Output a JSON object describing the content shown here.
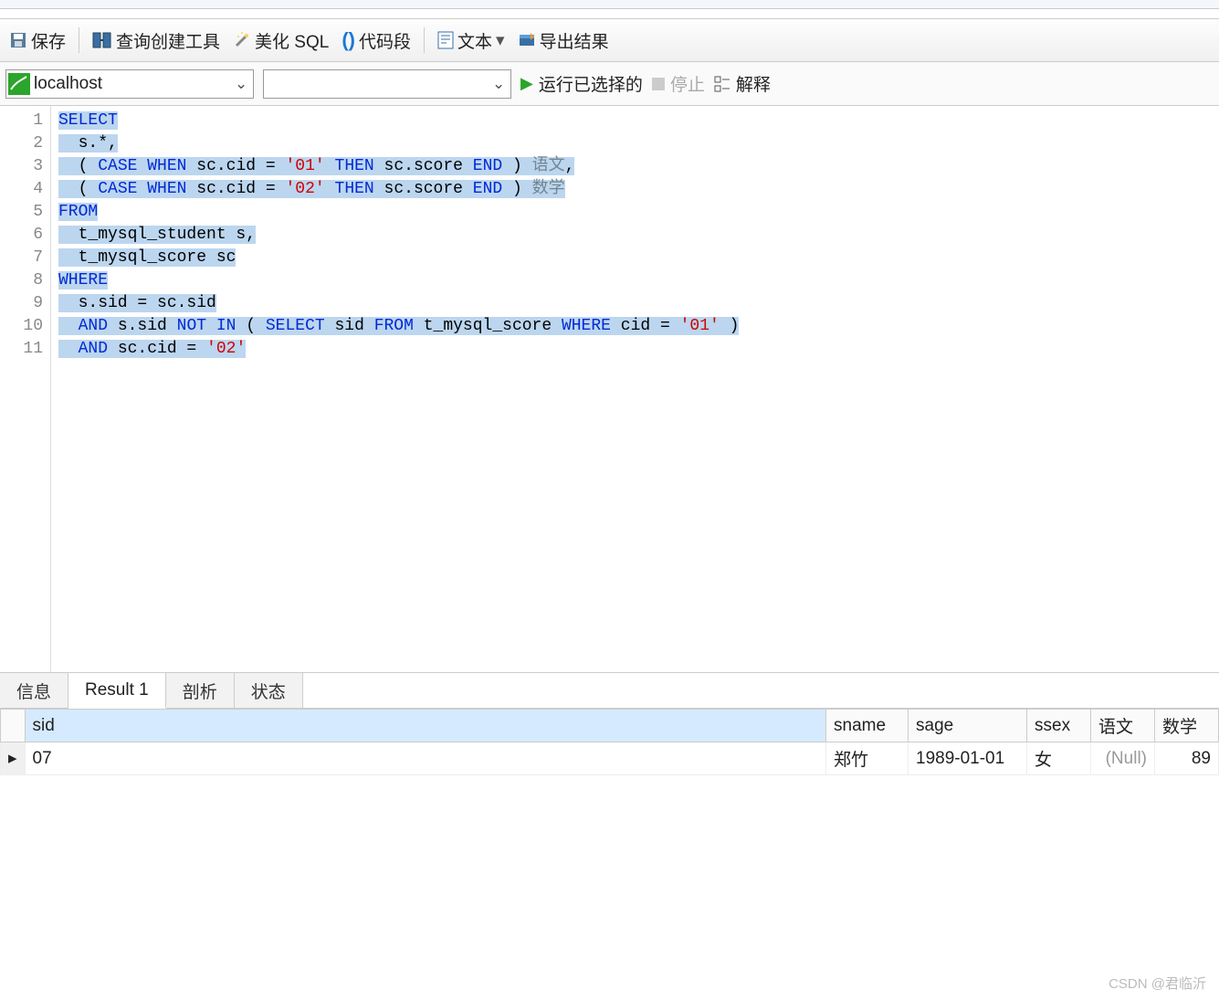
{
  "toolbar": {
    "save": "保存",
    "query_builder": "查询创建工具",
    "beautify": "美化 SQL",
    "snippet": "代码段",
    "text": "文本",
    "export": "导出结果"
  },
  "toolbar2": {
    "connection": "localhost",
    "run_selected": "运行已选择的",
    "stop": "停止",
    "explain": "解释"
  },
  "code": {
    "lines": [
      {
        "n": "1",
        "tokens": [
          {
            "c": "kw",
            "t": "SELECT"
          }
        ],
        "sel": true
      },
      {
        "n": "2",
        "tokens": [
          {
            "c": "txt",
            "t": "  s.*,"
          }
        ],
        "sel": true
      },
      {
        "n": "3",
        "tokens": [
          {
            "c": "txt",
            "t": "  ( "
          },
          {
            "c": "kw",
            "t": "CASE"
          },
          {
            "c": "txt",
            "t": " "
          },
          {
            "c": "kw",
            "t": "WHEN"
          },
          {
            "c": "txt",
            "t": " sc.cid = "
          },
          {
            "c": "str",
            "t": "'01'"
          },
          {
            "c": "txt",
            "t": " "
          },
          {
            "c": "kw",
            "t": "THEN"
          },
          {
            "c": "txt",
            "t": " sc.score "
          },
          {
            "c": "kw",
            "t": "END"
          },
          {
            "c": "txt",
            "t": " ) "
          },
          {
            "c": "fn",
            "t": "语文"
          },
          {
            "c": "txt",
            "t": ","
          }
        ],
        "sel": true
      },
      {
        "n": "4",
        "tokens": [
          {
            "c": "txt",
            "t": "  ( "
          },
          {
            "c": "kw",
            "t": "CASE"
          },
          {
            "c": "txt",
            "t": " "
          },
          {
            "c": "kw",
            "t": "WHEN"
          },
          {
            "c": "txt",
            "t": " sc.cid = "
          },
          {
            "c": "str",
            "t": "'02'"
          },
          {
            "c": "txt",
            "t": " "
          },
          {
            "c": "kw",
            "t": "THEN"
          },
          {
            "c": "txt",
            "t": " sc.score "
          },
          {
            "c": "kw",
            "t": "END"
          },
          {
            "c": "txt",
            "t": " ) "
          },
          {
            "c": "fn",
            "t": "数学"
          }
        ],
        "sel": true
      },
      {
        "n": "5",
        "tokens": [
          {
            "c": "kw",
            "t": "FROM"
          }
        ],
        "sel": true
      },
      {
        "n": "6",
        "tokens": [
          {
            "c": "txt",
            "t": "  t_mysql_student s,"
          }
        ],
        "sel": true
      },
      {
        "n": "7",
        "tokens": [
          {
            "c": "txt",
            "t": "  t_mysql_score sc"
          }
        ],
        "sel": true
      },
      {
        "n": "8",
        "tokens": [
          {
            "c": "kw",
            "t": "WHERE"
          }
        ],
        "sel": true
      },
      {
        "n": "9",
        "tokens": [
          {
            "c": "txt",
            "t": "  s.sid = sc.sid"
          }
        ],
        "sel": true
      },
      {
        "n": "10",
        "tokens": [
          {
            "c": "txt",
            "t": "  "
          },
          {
            "c": "kw",
            "t": "AND"
          },
          {
            "c": "txt",
            "t": " s.sid "
          },
          {
            "c": "kw",
            "t": "NOT"
          },
          {
            "c": "txt",
            "t": " "
          },
          {
            "c": "kw",
            "t": "IN"
          },
          {
            "c": "txt",
            "t": " ( "
          },
          {
            "c": "kw",
            "t": "SELECT"
          },
          {
            "c": "txt",
            "t": " sid "
          },
          {
            "c": "kw",
            "t": "FROM"
          },
          {
            "c": "txt",
            "t": " t_mysql_score "
          },
          {
            "c": "kw",
            "t": "WHERE"
          },
          {
            "c": "txt",
            "t": " cid = "
          },
          {
            "c": "str",
            "t": "'01'"
          },
          {
            "c": "txt",
            "t": " )"
          }
        ],
        "sel": true
      },
      {
        "n": "11",
        "tokens": [
          {
            "c": "txt",
            "t": "  "
          },
          {
            "c": "kw",
            "t": "AND"
          },
          {
            "c": "txt",
            "t": " sc.cid = "
          },
          {
            "c": "str",
            "t": "'02'"
          }
        ],
        "sel": true
      }
    ]
  },
  "result_tabs": {
    "info": "信息",
    "result1": "Result 1",
    "profile": "剖析",
    "status": "状态"
  },
  "result": {
    "columns": [
      "sid",
      "sname",
      "sage",
      "ssex",
      "语文",
      "数学"
    ],
    "rows": [
      {
        "sid": "07",
        "sname": "郑竹",
        "sage": "1989-01-01",
        "ssex": "女",
        "语文": "(Null)",
        "数学": "89"
      }
    ]
  },
  "watermark": "CSDN @君临沂"
}
